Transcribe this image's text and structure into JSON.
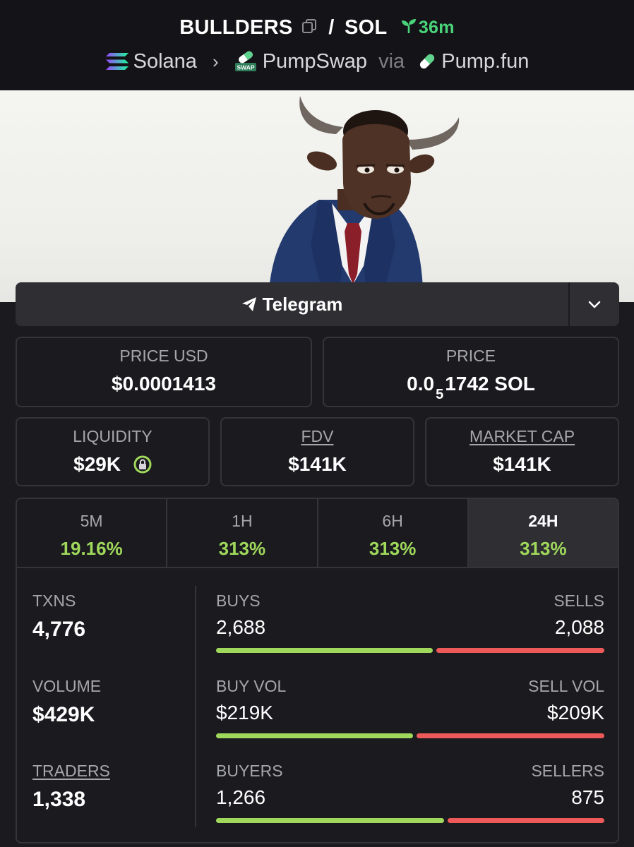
{
  "header": {
    "token": "BULLDERS",
    "pair_sep": "/",
    "quote": "SOL",
    "age": "36m",
    "chain": "Solana",
    "dex": "PumpSwap",
    "via": "via",
    "launchpad": "Pump.fun",
    "dex_badge": "SWAP"
  },
  "telegram": {
    "label": "Telegram"
  },
  "price_usd": {
    "label": "PRICE USD",
    "value": "$0.0001413"
  },
  "price_native": {
    "label": "PRICE",
    "prefix": "0.0",
    "zeros": "5",
    "digits": "1742",
    "unit": "SOL"
  },
  "liquidity": {
    "label": "LIQUIDITY",
    "value": "$29K"
  },
  "fdv": {
    "label": "FDV",
    "value": "$141K"
  },
  "market_cap": {
    "label": "MARKET CAP",
    "value": "$141K"
  },
  "timeframes": [
    {
      "label": "5M",
      "value": "19.16%"
    },
    {
      "label": "1H",
      "value": "313%"
    },
    {
      "label": "6H",
      "value": "313%"
    },
    {
      "label": "24H",
      "value": "313%"
    }
  ],
  "stats": {
    "txns": {
      "label": "TXNS",
      "value": "4,776"
    },
    "volume": {
      "label": "VOLUME",
      "value": "$429K"
    },
    "traders": {
      "label": "TRADERS",
      "value": "1,338"
    },
    "buys": {
      "label": "BUYS",
      "value": "2,688"
    },
    "sells": {
      "label": "SELLS",
      "value": "2,088"
    },
    "buy_vol": {
      "label": "BUY VOL",
      "value": "$219K"
    },
    "sell_vol": {
      "label": "SELL VOL",
      "value": "$209K"
    },
    "buyers": {
      "label": "BUYERS",
      "value": "1,266"
    },
    "sellers": {
      "label": "SELLERS",
      "value": "875"
    },
    "buy_ratio": {
      "txns": 0.563,
      "volume": 0.512,
      "makers": 0.591
    }
  },
  "colors": {
    "positive": "#9fd85b",
    "negative": "#ee5a5a",
    "age": "#4ad47a",
    "background": "#1a1a1f",
    "header_bg": "#141418"
  },
  "icons": [
    "copy-icon",
    "sprout-icon",
    "solana-icon",
    "chevron-right-icon",
    "pumpswap-icon",
    "pill-icon",
    "telegram-icon",
    "chevron-down-icon",
    "lock-icon"
  ]
}
